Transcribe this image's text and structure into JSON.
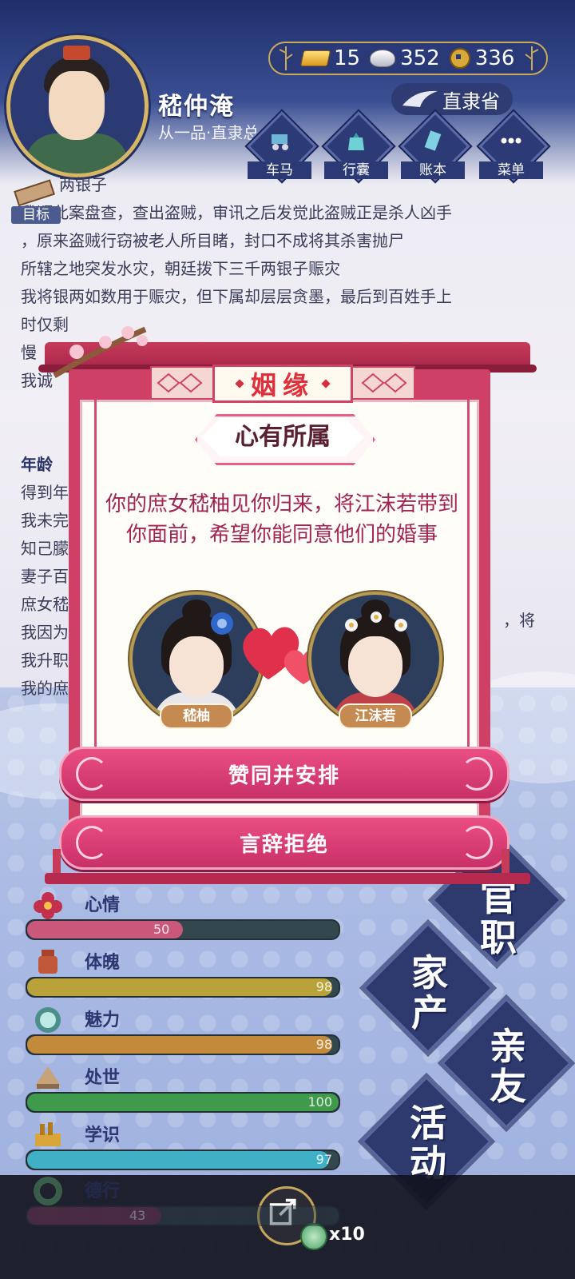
{
  "header": {
    "player_name": "嵇仲淹",
    "player_rank": "从一品·直隶总",
    "currency": {
      "gold": "15",
      "silver": "352",
      "coins": "336"
    },
    "location": "直隶省",
    "menu": [
      {
        "label": "车马",
        "icon": "carriage-icon"
      },
      {
        "label": "行囊",
        "icon": "bag-icon"
      },
      {
        "label": "账本",
        "icon": "ledger-icon"
      },
      {
        "label": "菜单",
        "icon": "more-icon"
      }
    ],
    "target_label": "目标"
  },
  "log": {
    "lines": [
      "两银子",
      "我顺此案盘查，查出盗贼，审讯之后发觉此盗贼正是杀人凶手",
      "，原来盗贼行窃被老人所目睹，封口不成将其杀害抛尸",
      "所辖之地突发水灾，朝廷拨下三千两银子赈灾",
      "我将银两如数用于赈灾，但下属却层层贪墨，最后到百姓手上",
      "时仅剩"
    ],
    "line_tail": "慢",
    "line_tail2": "我诚",
    "age_label": "年龄",
    "lines2": [
      "得到年",
      "我未完",
      "知己朦",
      "妻子百",
      "庶女嵇",
      "我因为",
      "我升职",
      "我的庶"
    ],
    "right_fragment": "，将"
  },
  "stats": [
    {
      "label": "心情",
      "value": 50,
      "max": 100,
      "icon": "flower-icon",
      "color": "#c9587a"
    },
    {
      "label": "体魄",
      "value": 98,
      "max": 100,
      "icon": "helmet-icon",
      "color": "#b9a23a"
    },
    {
      "label": "魅力",
      "value": 98,
      "max": 100,
      "icon": "mirror-icon",
      "color": "#c28a3a"
    },
    {
      "label": "处世",
      "value": 100,
      "max": 100,
      "icon": "fan-icon",
      "color": "#3f9a4c"
    },
    {
      "label": "学识",
      "value": 97,
      "max": 100,
      "icon": "books-icon",
      "color": "#3fb0c5"
    },
    {
      "label": "德行",
      "value": 43,
      "max": 100,
      "icon": "jade-ring-icon",
      "color": "#7b3a5c"
    }
  ],
  "side_buttons": {
    "official": "官职",
    "estate": "家产",
    "relatives": "亲友",
    "activities": "活动"
  },
  "bottom": {
    "share_count": "x10"
  },
  "dialog": {
    "tag": "姻缘",
    "subtitle": "心有所属",
    "text": "你的庶女嵇柚见你归来，将江沫若带到你面前，希望你能同意他们的婚事",
    "left_name": "嵇柚",
    "right_name": "江沫若",
    "accept_label": "赞同并安排",
    "reject_label": "言辞拒绝"
  },
  "colors": {
    "dialog_pink": "#cf4066",
    "button_pink": "#e24379",
    "header_navy": "#2a3977",
    "gold_trim": "#c9a95a"
  }
}
